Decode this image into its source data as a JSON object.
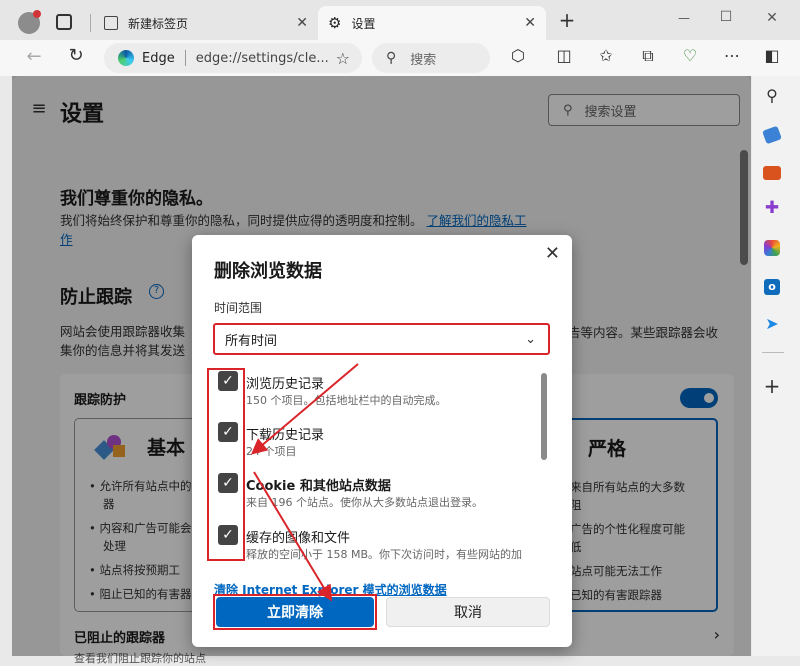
{
  "browser": {
    "tabs": [
      {
        "label": "新建标签页"
      },
      {
        "label": "设置"
      }
    ],
    "new_tab_symbol": "+",
    "window_controls": {
      "minimize": "—",
      "maximize": "☐",
      "close": "✕"
    },
    "address": {
      "brand": "Edge",
      "url": "edge://settings/cle..."
    },
    "search_placeholder": "搜索"
  },
  "settings": {
    "title": "设置",
    "search_placeholder": "搜索设置",
    "privacy_heading": "我们尊重你的隐私。",
    "privacy_text": "我们将始终保护和尊重你的隐私，同时提供应得的透明度和控制。",
    "privacy_link_a": "了解我们的隐私工",
    "privacy_link_b": "作",
    "tracking_heading": "防止跟踪",
    "tracking_text_a": "网站会使用跟踪器收集",
    "tracking_text_a_end": "告等内容。某些跟踪器会收",
    "tracking_text_b": "集你的信息并将其发送",
    "protection_label": "跟踪防护",
    "basic": {
      "title": "基本",
      "bullets": [
        "允许所有站点中的",
        "器",
        "内容和广告可能会",
        "处理",
        "站点将按预期工",
        "阻止已知的有害器"
      ]
    },
    "strict": {
      "title": "严格",
      "bullets": [
        "来自所有站点的大多数",
        "阻",
        "广告的个性化程度可能",
        "低",
        "站点可能无法工作",
        "已知的有害跟踪器"
      ]
    },
    "blocked_trackers": "已阻止的跟踪器",
    "blocked_bottom": "查看我们阻止跟踪你的站点"
  },
  "dialog": {
    "title": "删除浏览数据",
    "range_label": "时间范围",
    "range_value": "所有时间",
    "items": [
      {
        "title": "浏览历史记录",
        "desc": "150 个项目。包括地址栏中的自动完成。"
      },
      {
        "title": "下载历史记录",
        "desc": "24 个项目"
      },
      {
        "title": "Cookie 和其他站点数据",
        "desc": "来自 196 个站点。使你从大多数站点退出登录。"
      },
      {
        "title": "缓存的图像和文件",
        "desc": "释放的空间小于 158 MB。你下次访问时，有些网站的加"
      }
    ],
    "ie_link": "清除 Internet Explorer 模式的浏览数据",
    "clear_button": "立即清除",
    "cancel_button": "取消"
  },
  "colors": {
    "accent": "#0067c0",
    "annotation_red": "#d9252a"
  }
}
